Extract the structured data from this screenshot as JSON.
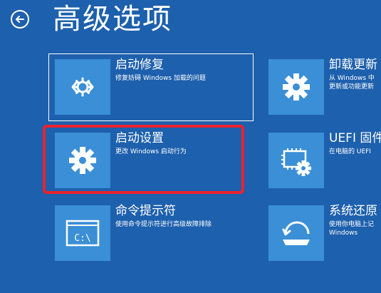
{
  "header": {
    "title": "高级选项",
    "back_icon": "back-arrow-icon"
  },
  "options": [
    {
      "label": "启动修复",
      "desc": "修复妨碍 Windows 加载的问题",
      "icon": "startup-repair-icon"
    },
    {
      "label": "启动设置",
      "desc": "更改 Windows 启动行为",
      "icon": "gear-icon"
    },
    {
      "label": "命令提示符",
      "desc": "使用命令提示符进行高级故障排除",
      "icon": "command-prompt-icon",
      "icon_text": "C:\\"
    },
    {
      "label": "卸载更新",
      "desc": "从 Windows 中\n更新或功能更新",
      "icon": "gear-icon"
    },
    {
      "label": "UEFI 固件",
      "desc": "在电脑的 UEFI",
      "icon": "uefi-chip-gear-icon"
    },
    {
      "label": "系统还原",
      "desc": "使用你电脑上记\nWindows",
      "icon": "system-restore-icon"
    }
  ],
  "colors": {
    "background": "#1d60ad",
    "tile": "#3a8fd6",
    "highlight": "#e8232f",
    "text": "#ffffff"
  }
}
